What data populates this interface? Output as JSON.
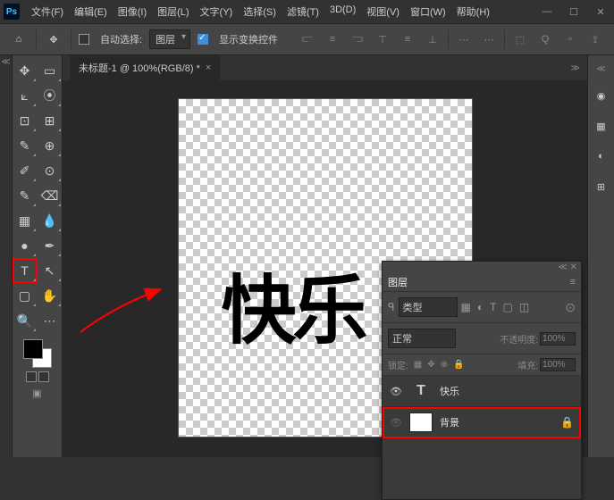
{
  "app": {
    "logo": "Ps"
  },
  "menus": [
    "文件(F)",
    "编辑(E)",
    "图像(I)",
    "图层(L)",
    "文字(Y)",
    "选择(S)",
    "滤镜(T)",
    "3D(D)",
    "视图(V)",
    "窗口(W)",
    "帮助(H)"
  ],
  "toolbar": {
    "auto_select_label": "自动选择:",
    "auto_select_checked": false,
    "select_target": "图层",
    "show_transform_label": "显示变换控件",
    "show_transform_checked": true
  },
  "doc_tab": {
    "title": "未标题-1 @ 100%(RGB/8) *"
  },
  "canvas": {
    "text": "快乐"
  },
  "layers_panel": {
    "title": "图层",
    "filter_type": "类型",
    "blend_mode": "正常",
    "opacity_label": "不透明度:",
    "opacity_value": "100%",
    "lock_label": "锁定:",
    "fill_label": "填充:",
    "fill_value": "100%",
    "layers": [
      {
        "name": "快乐",
        "type": "text",
        "visible": true,
        "selected": false,
        "locked": false
      },
      {
        "name": "背景",
        "type": "raster",
        "visible": true,
        "selected": true,
        "locked": true
      }
    ]
  }
}
